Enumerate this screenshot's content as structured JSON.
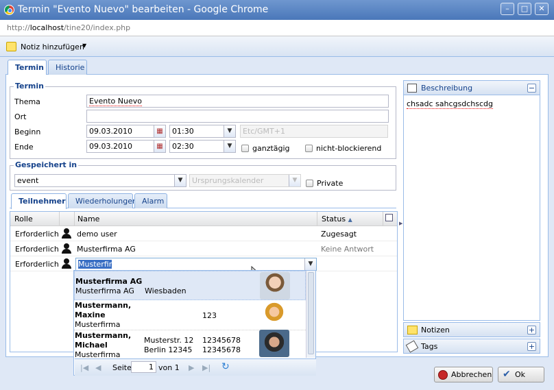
{
  "window": {
    "title": "Termin \"Evento Nuevo\" bearbeiten - Google Chrome",
    "url_prefix": "http://",
    "url_host": "localhost",
    "url_path": "/tine20/index.php"
  },
  "toolbar": {
    "add_note_label": "Notiz hinzufügen"
  },
  "tabs": [
    {
      "label": "Termin"
    },
    {
      "label": "Historie"
    }
  ],
  "termin": {
    "legend": "Termin",
    "thema_label": "Thema",
    "thema_value": "Evento Nuevo",
    "ort_label": "Ort",
    "ort_value": "",
    "beginn_label": "Beginn",
    "beginn_date": "09.03.2010",
    "beginn_time": "01:30",
    "timezone_placeholder": "Etc/GMT+1",
    "ende_label": "Ende",
    "ende_date": "09.03.2010",
    "ende_time": "02:30",
    "allday_label": "ganztägig",
    "nonblocking_label": "nicht-blockierend"
  },
  "saved_in": {
    "legend": "Gespeichert in",
    "value": "event",
    "origin_placeholder": "Ursprungskalender",
    "private_label": "Private"
  },
  "subtabs": [
    {
      "label": "Teilnehmer"
    },
    {
      "label": "Wiederholungen"
    },
    {
      "label": "Alarm"
    }
  ],
  "grid": {
    "headers": {
      "role": "Rolle",
      "name": "Name",
      "status": "Status"
    },
    "rows": [
      {
        "role": "Erforderlich",
        "name": "demo user",
        "status": "Zugesagt"
      },
      {
        "role": "Erforderlich",
        "name": "Musterfirma AG",
        "status": "Keine Antwort"
      },
      {
        "role": "Erforderlich",
        "name": "Musterfir",
        "status": ""
      }
    ]
  },
  "dropdown": {
    "items": [
      {
        "name": "Musterfirma AG",
        "company": "Musterfirma AG",
        "city": "Wiesbaden",
        "phone": "",
        "street": ""
      },
      {
        "name_line1": "Mustermann,",
        "name_line2": "Maxine",
        "company": "Musterfirma",
        "phone": "123"
      },
      {
        "name_line1": "Mustermann,",
        "name_line2": "Michael",
        "company": "Musterfirma",
        "street": "Musterstr. 12",
        "city": "Berlin 12345",
        "phone": "12345678",
        "phone2": "12345678"
      }
    ],
    "pager": {
      "page_label": "Seite",
      "page_value": "1",
      "of_label": "von 1"
    }
  },
  "sidebar": {
    "description_title": "Beschreibung",
    "description_text": "chsadc sahcgsdchscdg",
    "notes_title": "Notizen",
    "tags_title": "Tags"
  },
  "buttons": {
    "cancel": "Abbrechen",
    "ok": "Ok"
  },
  "colors": {
    "accent": "#15428b",
    "panel_border": "#99bbe8",
    "panel_bg": "#dfe8f6"
  }
}
